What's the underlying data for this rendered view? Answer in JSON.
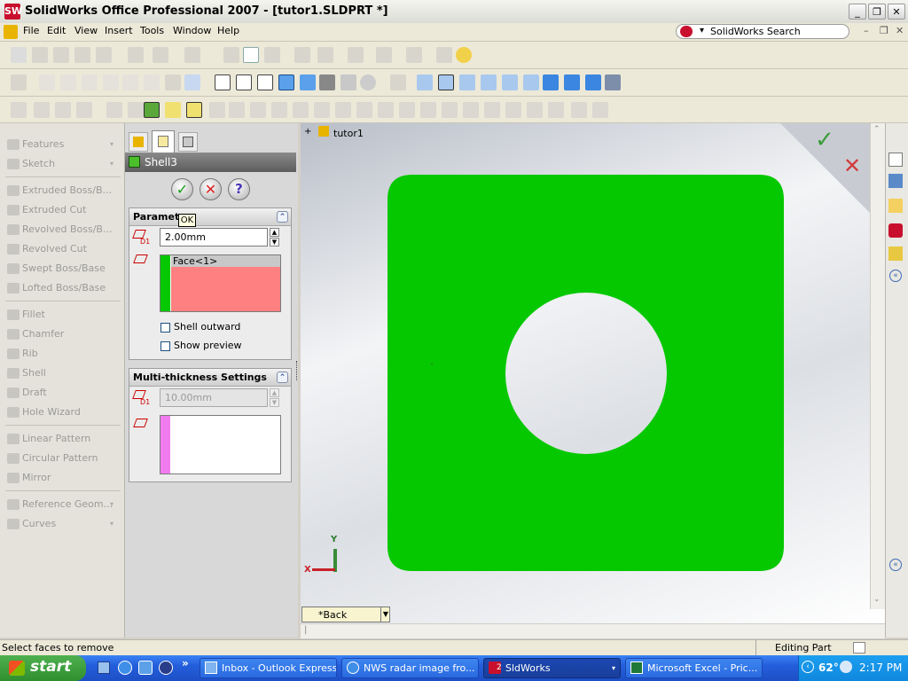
{
  "window": {
    "title": "SolidWorks Office Professional 2007 - [tutor1.SLDPRT *]",
    "app_icon": "SW",
    "minimize": "_",
    "restore": "❐",
    "close": "✕"
  },
  "menu": {
    "items": [
      "File",
      "Edit",
      "View",
      "Insert",
      "Tools",
      "Window",
      "Help"
    ],
    "search_label": "SolidWorks Search"
  },
  "command_manager": {
    "groups": [
      {
        "label": "Features"
      },
      {
        "label": "Sketch"
      }
    ],
    "features": [
      "Extruded Boss/B...",
      "Extruded Cut",
      "Revolved Boss/B...",
      "Revolved Cut",
      "Swept Boss/Base",
      "Lofted Boss/Base",
      "Fillet",
      "Chamfer",
      "Rib",
      "Shell",
      "Draft",
      "Hole Wizard",
      "Linear Pattern",
      "Circular Pattern",
      "Mirror",
      "Reference Geom...",
      "Curves"
    ]
  },
  "property_manager": {
    "feature_title": "Shell3",
    "ok_tooltip": "OK",
    "parameters": {
      "header": "Parameters",
      "thickness_value": "2.00mm",
      "face_item": "Face<1>",
      "shell_outward": "Shell outward",
      "show_preview": "Show preview"
    },
    "multi_thickness": {
      "header": "Multi-thickness Settings",
      "thickness_value": "10.00mm"
    },
    "d1_label": "D1"
  },
  "graphics": {
    "tree_root": "tutor1",
    "view_orientation": "*Back",
    "axis_x": "X",
    "axis_y": "Y",
    "part_color": "#06c800",
    "hole_color": "#a9adb8"
  },
  "status_bar": {
    "message": "Select faces to remove",
    "mode": "Editing Part"
  },
  "taskbar": {
    "start": "start",
    "tasks": [
      "Inbox - Outlook Express",
      "NWS radar image fro...",
      "SldWorks",
      "Microsoft Excel - Pric..."
    ],
    "sldworks_count": "2",
    "temperature": "62°",
    "clock": "2:17 PM"
  }
}
